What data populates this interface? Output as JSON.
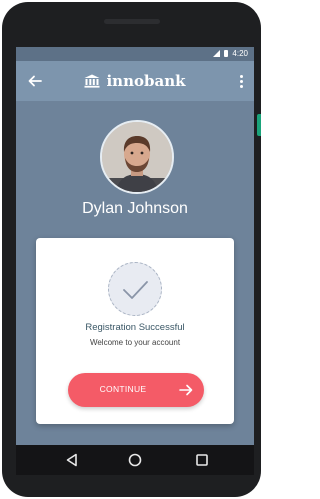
{
  "status_bar": {
    "time": "4:20"
  },
  "app_bar": {
    "brand": "innobank"
  },
  "profile": {
    "name": "Dylan Johnson"
  },
  "card": {
    "title": "Registration Successful",
    "subtitle": "Welcome to your account",
    "button_label": "CONTINUE"
  },
  "colors": {
    "accent": "#f45b67",
    "app_bar": "#7d95ad",
    "screen_bg": "#6e839a"
  },
  "icons": [
    "arrow-left-icon",
    "bank-icon",
    "more-vertical-icon",
    "check-icon",
    "arrow-right-icon",
    "nav-back-icon",
    "nav-home-icon",
    "nav-recent-icon"
  ]
}
